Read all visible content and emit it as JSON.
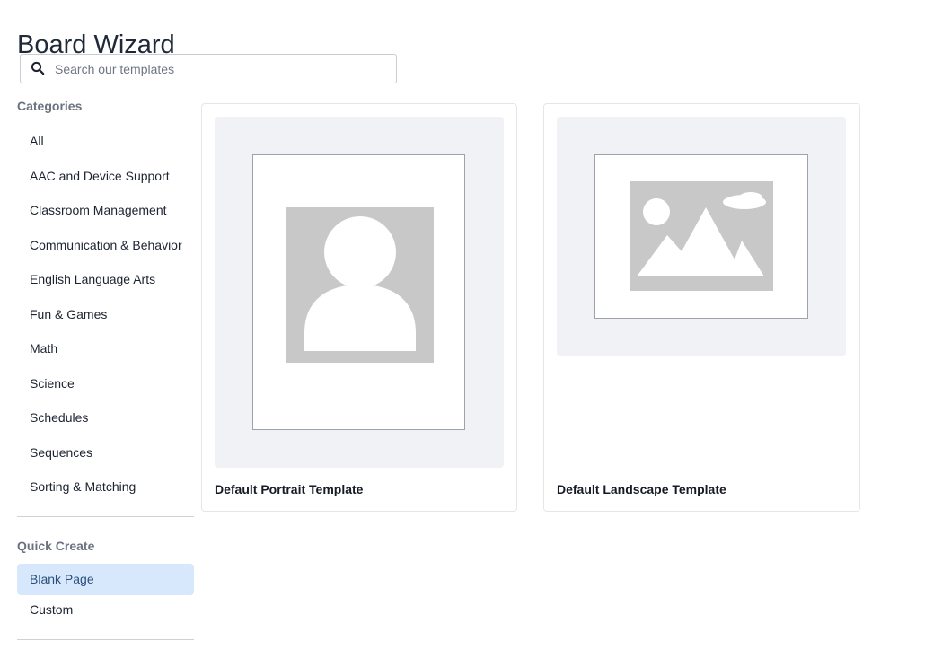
{
  "page": {
    "title": "Board Wizard"
  },
  "search": {
    "placeholder": "Search our templates",
    "icon": "search-icon"
  },
  "sidebar": {
    "categories_heading": "Categories",
    "categories": [
      {
        "label": "All"
      },
      {
        "label": "AAC and Device Support"
      },
      {
        "label": "Classroom Management"
      },
      {
        "label": "Communication & Behavior"
      },
      {
        "label": "English Language Arts"
      },
      {
        "label": "Fun & Games"
      },
      {
        "label": "Math"
      },
      {
        "label": "Science"
      },
      {
        "label": "Schedules"
      },
      {
        "label": "Sequences"
      },
      {
        "label": "Sorting & Matching"
      }
    ],
    "quick_create_heading": "Quick Create",
    "quick_create": [
      {
        "label": "Blank Page",
        "selected": true
      },
      {
        "label": "Custom",
        "selected": false
      }
    ]
  },
  "templates": [
    {
      "label": "Default Portrait Template",
      "orientation": "portrait",
      "icon": "person-placeholder-icon"
    },
    {
      "label": "Default Landscape Template",
      "orientation": "landscape",
      "icon": "image-placeholder-icon"
    }
  ],
  "colors": {
    "accent_bg": "#d7e8fc",
    "accent_text": "#2a4f7d",
    "placeholder_gray": "#c8c8c8",
    "thumb_bg": "#f1f2f6"
  }
}
